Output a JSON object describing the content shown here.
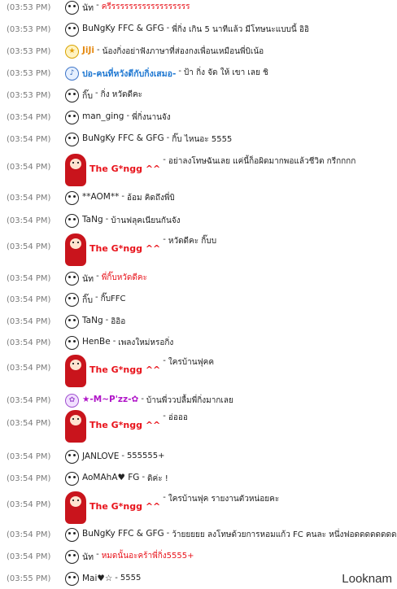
{
  "messages": [
    {
      "time": "(03:53 PM)",
      "icon": "skull-icon",
      "name": "นัท",
      "name_style": "plain",
      "msg": "ครีรรรรรรรรรรรรรรรรรร",
      "msg_style": "red"
    },
    {
      "time": "(03:53 PM)",
      "icon": "skull-icon",
      "name": "BuNgKy FFC & GFG",
      "name_style": "plain",
      "msg": "พี่กิ่ง เกิน 5 นาทีแล้ว มีโทษนะแบบนี้ อิอิ",
      "msg_style": "plain"
    },
    {
      "time": "(03:53 PM)",
      "icon": "star-icon",
      "name": "JiJi",
      "name_style": "orange",
      "msg": "น้องกิ่งอย่าฟังภาษาที่ส่องกงเพื่อนเหมือนพี่บิเน้อ",
      "msg_style": "plain"
    },
    {
      "time": "(03:53 PM)",
      "icon": "note-icon",
      "name": "ปอ-คนที่หวังดีกับกิ่งเสมอ-",
      "name_style": "blue",
      "msg": "ป้า กิ่ง จัด ให้ เขา เลย ชิ",
      "msg_style": "plain"
    },
    {
      "time": "(03:53 PM)",
      "icon": "skull-icon",
      "name": "กิ๊บ",
      "name_style": "plain",
      "msg": "กิ่ง หวัดดีคะ",
      "msg_style": "plain"
    },
    {
      "time": "(03:54 PM)",
      "icon": "skull-icon",
      "name": "man_ging",
      "name_style": "plain",
      "msg": "พี่กิ่งนานจัง",
      "msg_style": "plain"
    },
    {
      "time": "(03:54 PM)",
      "icon": "skull-icon",
      "name": "BuNgKy FFC & GFG",
      "name_style": "plain",
      "msg": "กิ๊บ ไหนอะ 5555",
      "msg_style": "plain"
    },
    {
      "time": "(03:54 PM)",
      "icon": "avatar",
      "name": "The G*ngg ^^",
      "name_style": "red",
      "msg": "อย่าลงโทษฉันเลย แค่นี้ก็อผิดมากพอแล้วชีวิต กรีกกกก",
      "msg_style": "plain"
    },
    {
      "time": "(03:54 PM)",
      "icon": "skull-icon",
      "name": "**AOM**",
      "name_style": "plain",
      "msg": "อ้อม คิดถึงพี่บิ",
      "msg_style": "plain"
    },
    {
      "time": "(03:54 PM)",
      "icon": "skull-icon",
      "name": "TaNg",
      "name_style": "plain",
      "msg": "บ้านฟลุคเนียนกันจัง",
      "msg_style": "plain"
    },
    {
      "time": "(03:54 PM)",
      "icon": "avatar",
      "name": "The G*ngg ^^",
      "name_style": "red",
      "msg": "หวัดดีคะ กิ๊บบ",
      "msg_style": "plain"
    },
    {
      "time": "(03:54 PM)",
      "icon": "skull-icon",
      "name": "นัท",
      "name_style": "plain",
      "msg": "พี่กิ๊บหวัดดีคะ",
      "msg_style": "red"
    },
    {
      "time": "(03:54 PM)",
      "icon": "skull-icon",
      "name": "กิ๊บ",
      "name_style": "plain",
      "msg": "กิ๊บFFC",
      "msg_style": "plain"
    },
    {
      "time": "(03:54 PM)",
      "icon": "skull-icon",
      "name": "TaNg",
      "name_style": "plain",
      "msg": "อิอิอ",
      "msg_style": "plain"
    },
    {
      "time": "(03:54 PM)",
      "icon": "skull-icon",
      "name": "HenBe",
      "name_style": "plain",
      "msg": "เพลงใหม่หรอกิ่ง",
      "msg_style": "plain"
    },
    {
      "time": "(03:54 PM)",
      "icon": "avatar",
      "name": "The G*ngg ^^",
      "name_style": "red",
      "msg": "ใครบ้านฟุคค",
      "msg_style": "plain"
    },
    {
      "time": "(03:54 PM)",
      "icon": "flower-icon",
      "name": "★-M~P'zz-✿",
      "name_style": "purple",
      "msg": "บ้านพี่ววปลื้มพี่กิ่งมากเลย",
      "msg_style": "plain"
    },
    {
      "time": "(03:54 PM)",
      "icon": "avatar",
      "name": "The G*ngg ^^",
      "name_style": "red",
      "msg": "อ่อออ",
      "msg_style": "plain"
    },
    {
      "time": "(03:54 PM)",
      "icon": "skull-icon",
      "name": "JANLOVE",
      "name_style": "plain",
      "msg": "555555+",
      "msg_style": "plain"
    },
    {
      "time": "(03:54 PM)",
      "icon": "skull-icon",
      "name": "AoMAhA♥ FG",
      "name_style": "plain",
      "msg": "ดิค่ะ !",
      "msg_style": "plain"
    },
    {
      "time": "(03:54 PM)",
      "icon": "avatar",
      "name": "The G*ngg ^^",
      "name_style": "red",
      "msg": "ใครบ้านฟุค รายงานตัวหน่อยคะ",
      "msg_style": "plain"
    },
    {
      "time": "(03:54 PM)",
      "icon": "skull-icon",
      "name": "BuNgKy FFC & GFG",
      "name_style": "plain",
      "msg": "ว้ายยยยย ลงโทษด้วยการหอมแก้ว FC คนละ หนึ่งฟอดดดดดดดดด",
      "msg_style": "plain"
    },
    {
      "time": "(03:54 PM)",
      "icon": "skull-icon",
      "name": "นัท",
      "name_style": "plain",
      "msg": "หมดนั้นอะคร้าพี่กิ่ง5555+",
      "msg_style": "red"
    },
    {
      "time": "(03:55 PM)",
      "icon": "skull-icon",
      "name": "Mai♥☆",
      "name_style": "plain",
      "msg": "5555",
      "msg_style": "plain"
    }
  ],
  "separator": "-",
  "watermark": "Looknam"
}
